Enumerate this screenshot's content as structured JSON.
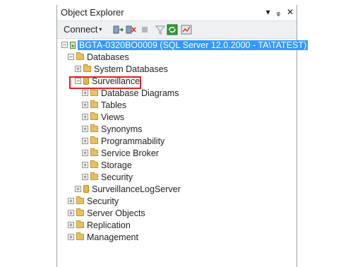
{
  "panel": {
    "title": "Object Explorer",
    "title_buttons": {
      "pin_menu": "▾",
      "pin": "ᵩ",
      "close": "✕"
    }
  },
  "toolbar": {
    "connect_label": "Connect",
    "connect_arrow": "▾",
    "icons": [
      "connect-object-explorer-icon",
      "disconnect-icon",
      "stop-icon",
      "filter-icon",
      "refresh-icon",
      "activity-monitor-icon"
    ]
  },
  "tree": {
    "server": "BGTA-0320BO0009 (SQL Server 12.0.2000 - TA\\TATEST)",
    "databases": "Databases",
    "system_databases": "System Databases",
    "surveillance": "Surveillance",
    "surveillance_children": [
      "Database Diagrams",
      "Tables",
      "Views",
      "Synonyms",
      "Programmability",
      "Service Broker",
      "Storage",
      "Security"
    ],
    "surveillance_log_server": "SurveillanceLogServer",
    "top_level": [
      "Security",
      "Server Objects",
      "Replication",
      "Management"
    ]
  },
  "colors": {
    "selection": "#3399ff",
    "highlight_box": "#e32020",
    "folder": "#e8c060"
  }
}
